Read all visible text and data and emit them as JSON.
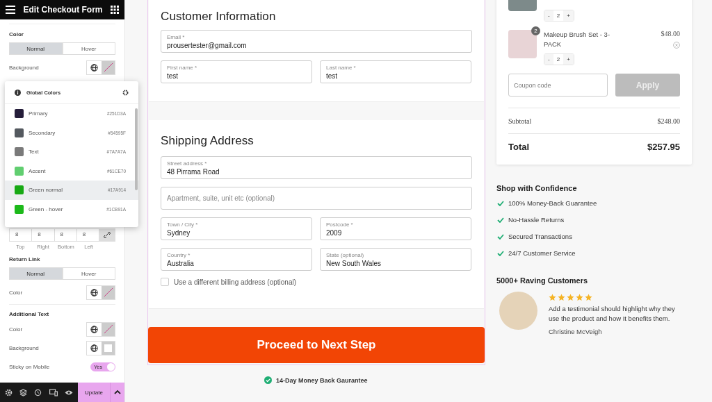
{
  "panel": {
    "title": "Edit Checkout Form",
    "sections": [
      {
        "kind": "heading",
        "label": "Color"
      },
      {
        "kind": "tabs",
        "tabs": [
          {
            "label": "Normal",
            "selected": true
          },
          {
            "label": "Hover",
            "selected": false
          }
        ]
      },
      {
        "kind": "color",
        "label": "Background",
        "empty": true
      },
      {
        "kind": "spacer"
      },
      {
        "kind": "dimensions",
        "values": [
          "8",
          "8",
          "8",
          "8"
        ],
        "labels": [
          "Top",
          "Right",
          "Bottom",
          "Left"
        ]
      },
      {
        "kind": "heading",
        "label": "Return Link"
      },
      {
        "kind": "tabs",
        "tabs": [
          {
            "label": "Normal",
            "selected": true
          },
          {
            "label": "Hover",
            "selected": false
          }
        ]
      },
      {
        "kind": "color",
        "label": "Color",
        "empty": true
      },
      {
        "kind": "divider"
      },
      {
        "kind": "heading",
        "label": "Additional Text"
      },
      {
        "kind": "color",
        "label": "Color",
        "empty": true
      },
      {
        "kind": "color",
        "label": "Background",
        "empty": false
      },
      {
        "kind": "toggle",
        "label": "Sticky on Mobile",
        "on": true,
        "value": "Yes"
      }
    ],
    "update_button": "Update"
  },
  "global_colors": {
    "title": "Global Colors",
    "items": [
      {
        "name": "Primary",
        "code": "#251D3A",
        "color": "#251d3a",
        "selected": false
      },
      {
        "name": "Secondary",
        "code": "#54595F",
        "color": "#54595f",
        "selected": false
      },
      {
        "name": "Text",
        "code": "#7A7A7A",
        "color": "#7a7a7a",
        "selected": false
      },
      {
        "name": "Accent",
        "code": "#61CE70",
        "color": "#61ce70",
        "selected": false
      },
      {
        "name": "Green normal",
        "code": "#17A914",
        "color": "#17a914",
        "selected": true
      },
      {
        "name": "Green - hover",
        "code": "#1CB91A",
        "color": "#1cb91a",
        "selected": false
      }
    ]
  },
  "customer": {
    "title": "Customer Information",
    "fields": [
      {
        "label": "Email *",
        "value": "prousertester@gmail.com",
        "half": false
      },
      {
        "label": "First name *",
        "value": "test",
        "half": true
      },
      {
        "label": "Last name *",
        "value": "test",
        "half": true
      }
    ]
  },
  "shipping": {
    "title": "Shipping Address",
    "fields": [
      {
        "label": "Street address *",
        "value": "48 Pirrama Road",
        "half": false
      },
      {
        "placeholder": "Apartment, suite, unit etc (optional)",
        "half": false
      },
      {
        "label": "Town / City *",
        "value": "Sydney",
        "half": true
      },
      {
        "label": "Postcode *",
        "value": "2009",
        "half": true
      },
      {
        "label": "Country *",
        "value": "Australia",
        "half": true
      },
      {
        "label": "State (optional)",
        "value": "New South Wales",
        "half": true
      }
    ],
    "billing_checkbox": {
      "label": "Use a different billing address (optional)",
      "checked": false
    }
  },
  "proceed_button": "Proceed to Next Step",
  "guarantee": "14-Day Money Back Gaurantee",
  "cart": {
    "items": [
      {
        "qty": "2"
      },
      {
        "name": "Makeup Brush Set - 3-PACK",
        "price": "$48.00",
        "qty": "2",
        "badge": "2"
      }
    ],
    "qty_minus": "-",
    "qty_plus": "+",
    "coupon_placeholder": "Coupon code",
    "apply_button": "Apply",
    "subtotal_label": "Subtotal",
    "subtotal": "$248.00",
    "total_label": "Total",
    "total": "$257.95"
  },
  "confidence": {
    "title": "Shop with Confidence",
    "items": [
      "100% Money-Back Guarantee",
      "No-Hassle Returns",
      "Secured Transactions",
      "24/7 Customer Service"
    ]
  },
  "reviews": {
    "title": "5000+ Raving Customers",
    "stars": 5,
    "text": "Add a testimonial should highlight why they use the product and how It benefits them.",
    "author": "Christine McVeigh"
  }
}
